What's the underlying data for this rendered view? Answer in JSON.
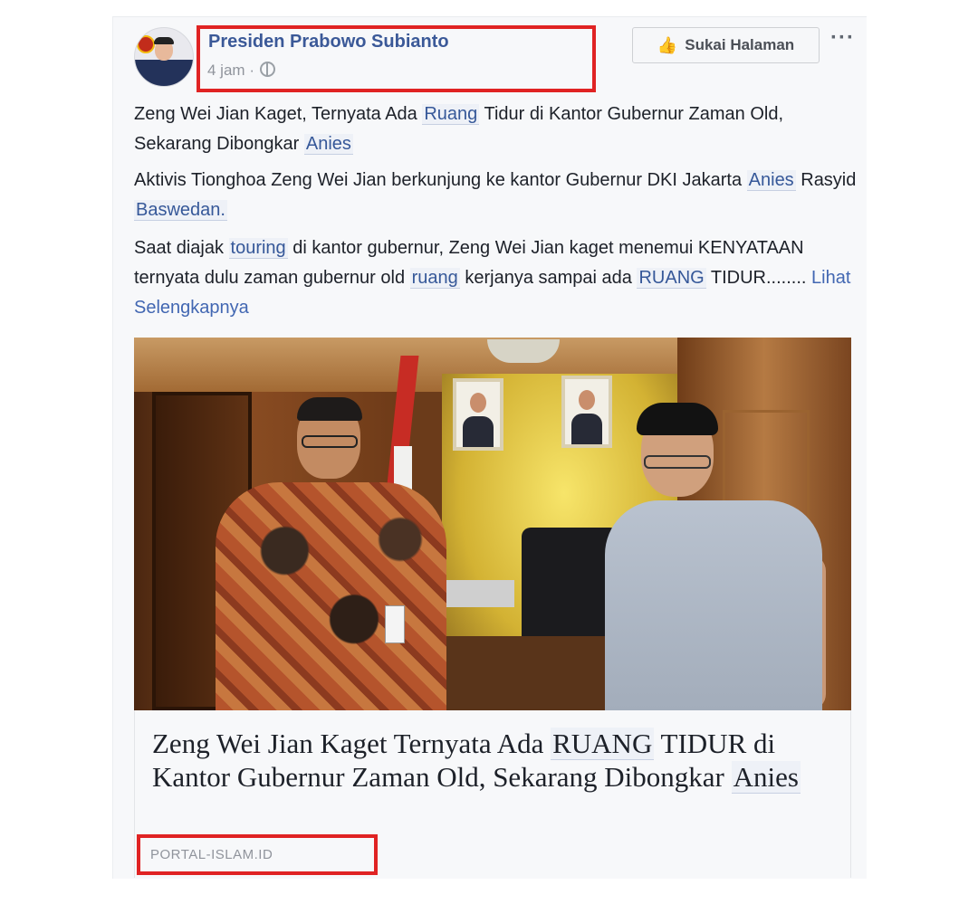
{
  "post": {
    "page_name": "Presiden Prabowo Subianto",
    "time": "4 jam",
    "time_sep": "·",
    "like_button": "Sukai Halaman",
    "more": "···",
    "paragraph1": {
      "a": "Zeng Wei Jian Kaget, Ternyata Ada ",
      "tag1": "Ruang",
      "b": " Tidur di Kantor Gubernur Zaman Old, Sekarang Dibongkar ",
      "tag2": "Anies"
    },
    "paragraph2": {
      "a": "Aktivis Tionghoa Zeng Wei Jian berkunjung ke kantor Gubernur DKI Jakarta ",
      "tag1": "Anies",
      "b": " Rasyid ",
      "tag2": "Baswedan."
    },
    "paragraph3": {
      "a": "Saat diajak ",
      "tag1": "touring",
      "b": " di kantor gubernur, Zeng Wei Jian kaget menemui KENYATAAN ternyata dulu zaman gubernur old ",
      "tag2": "ruang",
      "c": " kerjanya sampai ada ",
      "tag3": "RUANG",
      "d": " TIDUR........ ",
      "see_more": "Lihat Selengkapnya"
    }
  },
  "link": {
    "title_a": "Zeng Wei Jian Kaget Ternyata Ada ",
    "title_tag1": "RUANG",
    "title_b": " TIDUR di Kantor Gubernur Zaman Old, Sekarang Dibongkar ",
    "title_tag2": "Anies",
    "domain": "PORTAL-ISLAM.ID"
  },
  "colors": {
    "highlight_box": "#e02323",
    "page_name": "#3b5998",
    "see_more": "#4267b2"
  },
  "icons": {
    "like": "thumbs-up-icon",
    "privacy": "globe-icon",
    "more": "more-options-icon"
  }
}
